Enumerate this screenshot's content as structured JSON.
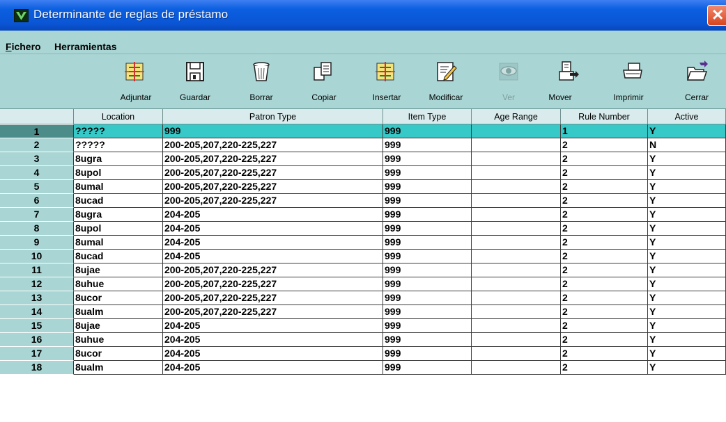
{
  "window": {
    "title": "Determinante de reglas de préstamo",
    "close_glyph": "✕"
  },
  "menu": {
    "items": [
      {
        "label": "Fichero",
        "accel": "F"
      },
      {
        "label": "Herramientas",
        "accel": "t"
      }
    ]
  },
  "toolbar": {
    "buttons": [
      {
        "label": "Adjuntar",
        "icon": "attach-icon",
        "enabled": true
      },
      {
        "label": "Guardar",
        "icon": "save-icon",
        "enabled": true
      },
      {
        "label": "Borrar",
        "icon": "trash-icon",
        "enabled": true
      },
      {
        "label": "Copiar",
        "icon": "copy-icon",
        "enabled": true
      },
      {
        "label": "Insertar",
        "icon": "insert-icon",
        "enabled": true
      },
      {
        "label": "Modificar",
        "icon": "edit-icon",
        "enabled": true
      },
      {
        "label": "Ver",
        "icon": "view-eye-icon",
        "enabled": false
      },
      {
        "label": "Mover",
        "icon": "move-icon",
        "enabled": true
      },
      {
        "label": "Imprimir",
        "icon": "printer-icon",
        "enabled": true
      },
      {
        "label": "Cerrar",
        "icon": "close-folder-icon",
        "enabled": true
      }
    ]
  },
  "table": {
    "columns": [
      "Location",
      "Patron Type",
      "Item Type",
      "Age Range",
      "Rule Number",
      "Active"
    ],
    "selected_row": 1,
    "rows": [
      {
        "n": "1",
        "location": "?????",
        "patron_type": "999",
        "item_type": "999",
        "age_range": "",
        "rule_number": "1",
        "active": "Y"
      },
      {
        "n": "2",
        "location": "?????",
        "patron_type": "200-205,207,220-225,227",
        "item_type": "999",
        "age_range": "",
        "rule_number": "2",
        "active": "N"
      },
      {
        "n": "3",
        "location": "8ugra",
        "patron_type": "200-205,207,220-225,227",
        "item_type": "999",
        "age_range": "",
        "rule_number": "2",
        "active": "Y"
      },
      {
        "n": "4",
        "location": "8upol",
        "patron_type": "200-205,207,220-225,227",
        "item_type": "999",
        "age_range": "",
        "rule_number": "2",
        "active": "Y"
      },
      {
        "n": "5",
        "location": "8umal",
        "patron_type": "200-205,207,220-225,227",
        "item_type": "999",
        "age_range": "",
        "rule_number": "2",
        "active": "Y"
      },
      {
        "n": "6",
        "location": "8ucad",
        "patron_type": "200-205,207,220-225,227",
        "item_type": "999",
        "age_range": "",
        "rule_number": "2",
        "active": "Y"
      },
      {
        "n": "7",
        "location": "8ugra",
        "patron_type": "204-205",
        "item_type": "999",
        "age_range": "",
        "rule_number": "2",
        "active": "Y"
      },
      {
        "n": "8",
        "location": "8upol",
        "patron_type": "204-205",
        "item_type": "999",
        "age_range": "",
        "rule_number": "2",
        "active": "Y"
      },
      {
        "n": "9",
        "location": "8umal",
        "patron_type": "204-205",
        "item_type": "999",
        "age_range": "",
        "rule_number": "2",
        "active": "Y"
      },
      {
        "n": "10",
        "location": "8ucad",
        "patron_type": "204-205",
        "item_type": "999",
        "age_range": "",
        "rule_number": "2",
        "active": "Y"
      },
      {
        "n": "11",
        "location": "8ujae",
        "patron_type": "200-205,207,220-225,227",
        "item_type": "999",
        "age_range": "",
        "rule_number": "2",
        "active": "Y"
      },
      {
        "n": "12",
        "location": "8uhue",
        "patron_type": "200-205,207,220-225,227",
        "item_type": "999",
        "age_range": "",
        "rule_number": "2",
        "active": "Y"
      },
      {
        "n": "13",
        "location": "8ucor",
        "patron_type": "200-205,207,220-225,227",
        "item_type": "999",
        "age_range": "",
        "rule_number": "2",
        "active": "Y"
      },
      {
        "n": "14",
        "location": "8ualm",
        "patron_type": "200-205,207,220-225,227",
        "item_type": "999",
        "age_range": "",
        "rule_number": "2",
        "active": "Y"
      },
      {
        "n": "15",
        "location": "8ujae",
        "patron_type": "204-205",
        "item_type": "999",
        "age_range": "",
        "rule_number": "2",
        "active": "Y"
      },
      {
        "n": "16",
        "location": "8uhue",
        "patron_type": "204-205",
        "item_type": "999",
        "age_range": "",
        "rule_number": "2",
        "active": "Y"
      },
      {
        "n": "17",
        "location": "8ucor",
        "patron_type": "204-205",
        "item_type": "999",
        "age_range": "",
        "rule_number": "2",
        "active": "Y"
      },
      {
        "n": "18",
        "location": "8ualm",
        "patron_type": "204-205",
        "item_type": "999",
        "age_range": "",
        "rule_number": "2",
        "active": "Y"
      }
    ]
  },
  "colors": {
    "titlebar": "#0a56d6",
    "chrome": "#a9d6d4",
    "selected_row": "#36c9c8",
    "selected_rownum": "#4c8c89"
  }
}
